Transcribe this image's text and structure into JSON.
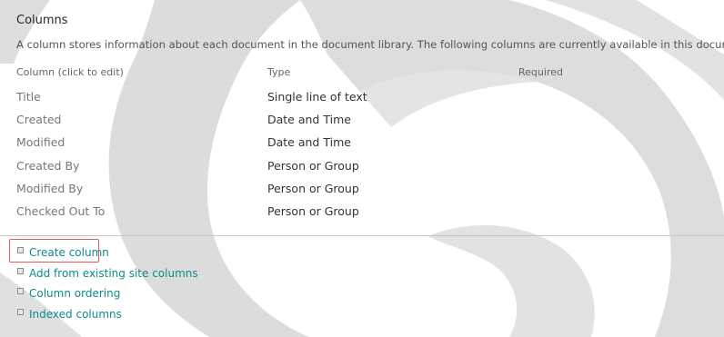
{
  "section": {
    "title": "Columns",
    "description": "A column stores information about each document in the document library. The following columns are currently available in this document library:"
  },
  "table": {
    "headers": [
      "Column (click to edit)",
      "Type",
      "Required"
    ],
    "rows": [
      {
        "name": "Title",
        "type": "Single line of text"
      },
      {
        "name": "Created",
        "type": "Date and Time"
      },
      {
        "name": "Modified",
        "type": "Date and Time"
      },
      {
        "name": "Created By",
        "type": "Person or Group"
      },
      {
        "name": "Modified By",
        "type": "Person or Group"
      },
      {
        "name": "Checked Out To",
        "type": "Person or Group"
      }
    ]
  },
  "links": [
    {
      "label": "Create column"
    },
    {
      "label": "Add from existing site columns"
    },
    {
      "label": "Column ordering"
    },
    {
      "label": "Indexed columns"
    }
  ],
  "colors": {
    "link": "#0f8a8a",
    "highlight": "#e05b5b",
    "background_swirl": "#dcdcdc"
  },
  "icons": {
    "bullet": "square-bullet-icon"
  }
}
